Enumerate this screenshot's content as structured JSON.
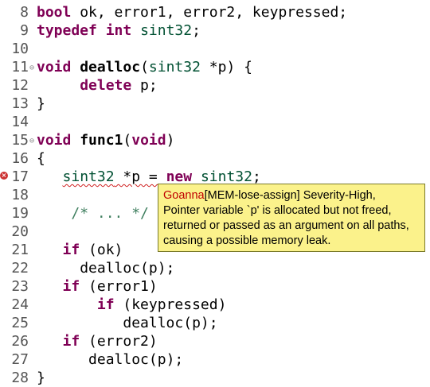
{
  "editor": {
    "lines": [
      {
        "num": "8",
        "indent": "",
        "tokens": [
          {
            "t": "kw",
            "v": "bool"
          },
          {
            "t": "p",
            "v": " ok, error1, error2, keypressed;"
          }
        ]
      },
      {
        "num": "9",
        "indent": "",
        "tokens": [
          {
            "t": "kw",
            "v": "typedef"
          },
          {
            "t": "p",
            "v": " "
          },
          {
            "t": "kw",
            "v": "int"
          },
          {
            "t": "p",
            "v": " "
          },
          {
            "t": "ty",
            "v": "sint32"
          },
          {
            "t": "p",
            "v": ";"
          }
        ]
      },
      {
        "num": "10",
        "indent": "",
        "tokens": []
      },
      {
        "num": "11",
        "indent": "",
        "fold": true,
        "tokens": [
          {
            "t": "kw",
            "v": "void"
          },
          {
            "t": "p",
            "v": " "
          },
          {
            "t": "fn",
            "v": "dealloc"
          },
          {
            "t": "p",
            "v": "("
          },
          {
            "t": "ty",
            "v": "sint32"
          },
          {
            "t": "p",
            "v": " *p) {"
          }
        ]
      },
      {
        "num": "12",
        "indent": "     ",
        "tokens": [
          {
            "t": "kw",
            "v": "delete"
          },
          {
            "t": "p",
            "v": " p;"
          }
        ]
      },
      {
        "num": "13",
        "indent": "",
        "tokens": [
          {
            "t": "p",
            "v": "}"
          }
        ]
      },
      {
        "num": "14",
        "indent": "",
        "tokens": []
      },
      {
        "num": "15",
        "indent": "",
        "fold": true,
        "tokens": [
          {
            "t": "kw",
            "v": "void"
          },
          {
            "t": "p",
            "v": " "
          },
          {
            "t": "fn",
            "v": "func1"
          },
          {
            "t": "p",
            "v": "("
          },
          {
            "t": "kw",
            "v": "void"
          },
          {
            "t": "p",
            "v": ")"
          }
        ]
      },
      {
        "num": "16",
        "indent": "",
        "tokens": [
          {
            "t": "p",
            "v": "{"
          }
        ]
      },
      {
        "num": "17",
        "indent": "   ",
        "error": true,
        "tokens": [
          {
            "t": "ty",
            "v": "sint32",
            "sq": true
          },
          {
            "t": "p",
            "v": " *p = ",
            "sq": true
          },
          {
            "t": "kw",
            "v": "new",
            "sq": true
          },
          {
            "t": "p",
            "v": " ",
            "sq": true
          },
          {
            "t": "ty",
            "v": "sint32",
            "sq": true
          },
          {
            "t": "p",
            "v": ";",
            "sq": true
          }
        ]
      },
      {
        "num": "18",
        "indent": "",
        "tokens": []
      },
      {
        "num": "19",
        "indent": "    ",
        "tokens": [
          {
            "t": "cm",
            "v": "/* ... */"
          }
        ]
      },
      {
        "num": "20",
        "indent": "",
        "tokens": []
      },
      {
        "num": "21",
        "indent": "   ",
        "tokens": [
          {
            "t": "kw",
            "v": "if"
          },
          {
            "t": "p",
            "v": " (ok)"
          }
        ]
      },
      {
        "num": "22",
        "indent": "     ",
        "tokens": [
          {
            "t": "p",
            "v": "dealloc(p);"
          }
        ]
      },
      {
        "num": "23",
        "indent": "   ",
        "tokens": [
          {
            "t": "kw",
            "v": "if"
          },
          {
            "t": "p",
            "v": " (error1)"
          }
        ]
      },
      {
        "num": "24",
        "indent": "       ",
        "tokens": [
          {
            "t": "kw",
            "v": "if"
          },
          {
            "t": "p",
            "v": " (keypressed)"
          }
        ]
      },
      {
        "num": "25",
        "indent": "          ",
        "tokens": [
          {
            "t": "p",
            "v": "dealloc(p);"
          }
        ]
      },
      {
        "num": "26",
        "indent": "   ",
        "tokens": [
          {
            "t": "kw",
            "v": "if"
          },
          {
            "t": "p",
            "v": " (error2)"
          }
        ]
      },
      {
        "num": "27",
        "indent": "      ",
        "tokens": [
          {
            "t": "p",
            "v": "dealloc(p);"
          }
        ]
      },
      {
        "num": "28",
        "indent": "",
        "tokens": [
          {
            "t": "p",
            "v": "}"
          }
        ]
      }
    ]
  },
  "tooltip": {
    "source": "Goanna",
    "rule": "[MEM-lose-assign] Severity-High,",
    "line2": "Pointer variable `p' is allocated but not freed,",
    "line3": "returned or passed as an argument on all paths,",
    "line4": "causing a possible memory leak."
  },
  "colors": {
    "keyword": "#7f0055",
    "type": "#005032",
    "comment": "#3f7f5f",
    "tooltip_bg": "#fbf28b",
    "tooltip_source": "#c00000",
    "error_marker": "#cc3333"
  },
  "icons": {
    "fold": "collapse-fold-icon",
    "error": "error-marker-icon"
  }
}
